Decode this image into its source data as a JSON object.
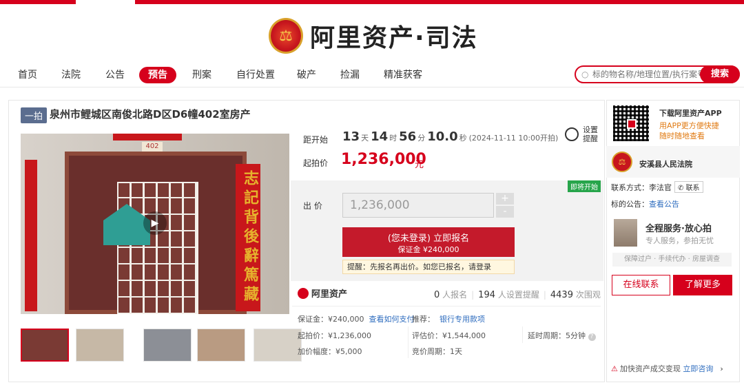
{
  "brand": {
    "title": "阿里资产·司法"
  },
  "nav": {
    "items": [
      "首页",
      "法院",
      "公告",
      "预告",
      "刑案",
      "自行处置",
      "破产",
      "捡漏",
      "精准获客"
    ],
    "active_index": 3
  },
  "search": {
    "placeholder": "标的物名称/地理位置/执行案号",
    "button": "搜索"
  },
  "item": {
    "tag": "一拍",
    "title": "泉州市鲤城区南俊北路D区D6幢402室房产"
  },
  "photo": {
    "plaque": "402",
    "couplet_right": "志記背後辭篤藏"
  },
  "countdown": {
    "label": "距开始",
    "days": "13",
    "days_unit": "天",
    "hours": "14",
    "hours_unit": "时",
    "minutes": "56",
    "minutes_unit": "分",
    "seconds": "10.0",
    "seconds_unit": "秒",
    "start": "(2024-11-11 10:00开拍)"
  },
  "remind": {
    "label": "设置提醒"
  },
  "starting_price": {
    "label": "起拍价",
    "value": "1,236,000",
    "unit": "元"
  },
  "bid": {
    "soon_badge": "即将开始",
    "label": "出 价",
    "input_value": "1,236,000",
    "plus": "+",
    "minus": "-",
    "signup_line1": "(您未登录) 立即报名",
    "signup_line2": "保证金 ¥240,000",
    "tip": "提醒：先报名再出价。如您已报名，请登录"
  },
  "platform": {
    "logo": "阿里资产"
  },
  "stats": {
    "signups": "0",
    "signups_label": "人报名",
    "reminders": "194",
    "reminders_label": "人设置提醒",
    "views": "4439",
    "views_label": "次围观"
  },
  "info": {
    "deposit": "保证金：¥240,000",
    "deposit_link": "查看如何支付",
    "recommend_label": "推荐：",
    "recommend_link": "银行专用款项",
    "start_price": "起拍价：¥1,236,000",
    "appraisal": "评估价：¥1,544,000",
    "delay": "延时周期：5分钟",
    "increment": "加价幅度：¥5,000",
    "auction_period": "竞价周期：1天"
  },
  "side": {
    "app_title": "下载阿里资产APP",
    "app_sub1": "用APP更方便快捷",
    "app_sub2": "随时随地查看",
    "court_name": "安溪县人民法院",
    "contact_label": "联系方式：李法官",
    "contact_btn": "联系",
    "notice_label": "标的公告：",
    "notice_link": "查看公告",
    "service_title": "全程服务·放心拍",
    "service_sub": "专人服务，参拍无忧",
    "service_tags": "保障过户 · 手续代办 · 房屋调查",
    "btn_online": "在线联系",
    "btn_more": "了解更多",
    "accel_text": "加快资产成交变现",
    "accel_link": "立即咨询"
  },
  "colors": {
    "accent": "#d6001c",
    "link": "#2f6dbf",
    "badge_green": "#27a54b"
  }
}
